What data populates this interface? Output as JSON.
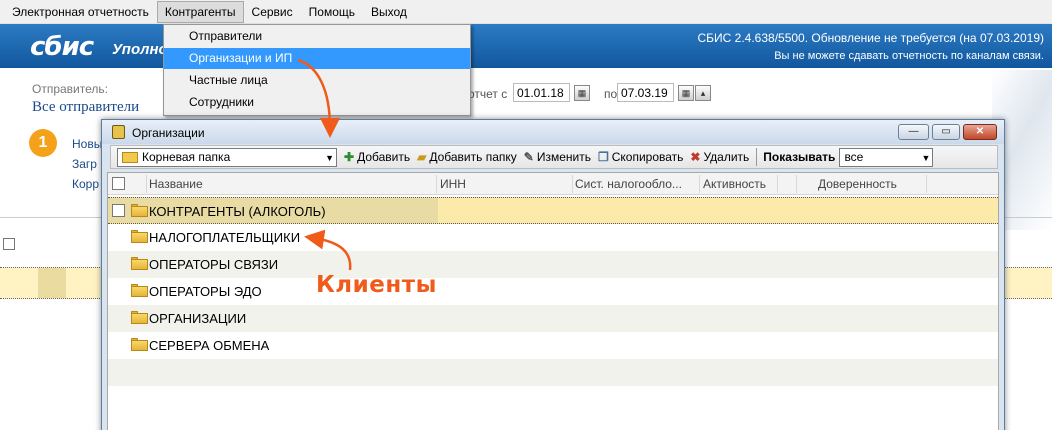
{
  "menubar": {
    "items": [
      "Электронная отчетность",
      "Контрагенты",
      "Сервис",
      "Помощь",
      "Выход"
    ],
    "active": "Контрагенты"
  },
  "header": {
    "logo": "сбис",
    "title": "Уполно",
    "version": "СБИС 2.4.638/5500. Обновление не требуется (на 07.03.2019)",
    "warning": "Вы не можете сдавать отчетность по каналам связи."
  },
  "background": {
    "sender_label": "Отправитель:",
    "sender_value": "Все отправители",
    "step_number": "1",
    "links": [
      "Новы",
      "Загр",
      "Корр"
    ],
    "period_label": "отчет с",
    "date_from": "01.01.18",
    "date_to_label": "по",
    "date_to": "07.03.19"
  },
  "dropdown": {
    "items": [
      "Отправители",
      "Организации и ИП",
      "Частные лица",
      "Сотрудники"
    ],
    "highlighted": "Организации и ИП"
  },
  "dialog": {
    "title": "Организации",
    "folder_combo": "Корневая папка",
    "toolbar": {
      "add": "Добавить",
      "add_folder": "Добавить папку",
      "edit": "Изменить",
      "copy": "Скопировать",
      "delete": "Удалить",
      "show_label": "Показывать",
      "show_value": "все"
    },
    "columns": [
      "Название",
      "ИНН",
      "Сист. налогообло...",
      "Активность",
      "Доверенность"
    ],
    "rows": [
      "КОНТРАГЕНТЫ (АЛКОГОЛЬ)",
      "НАЛОГОПЛАТЕЛЬЩИКИ",
      "ОПЕРАТОРЫ СВЯЗИ",
      "ОПЕРАТОРЫ ЭДО",
      "ОРГАНИЗАЦИИ",
      "СЕРВЕРА ОБМЕНА"
    ]
  },
  "annotation": {
    "label": "Клиенты",
    "color": "#f05a1a"
  },
  "colors": {
    "header_blue": "#1a66b0",
    "menu_highlight": "#3399ff",
    "selected_row": "#fbeaa9"
  }
}
